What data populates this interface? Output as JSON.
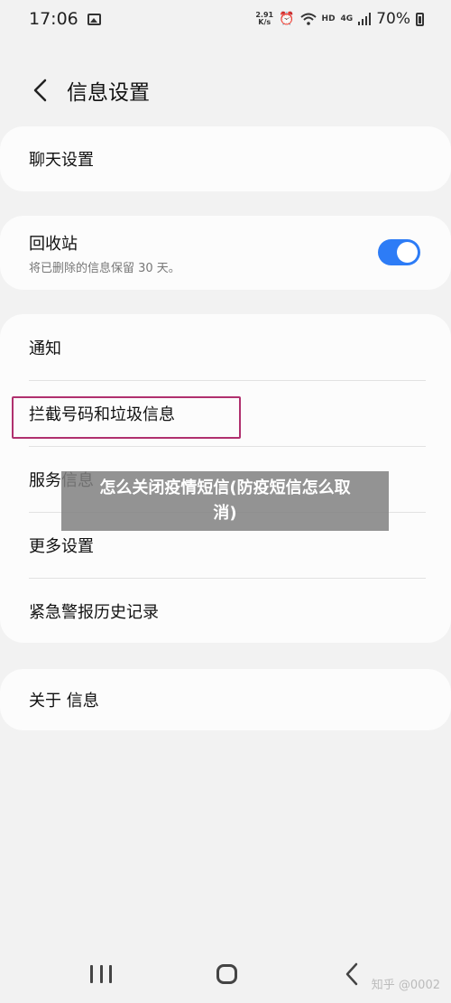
{
  "status_bar": {
    "time": "17:06",
    "net_speed_value": "2.91",
    "net_speed_unit": "K/s",
    "hd": "HD",
    "signal": "4G",
    "battery": "70%"
  },
  "header": {
    "title": "信息设置"
  },
  "settings": {
    "chat": "聊天设置",
    "recycle_bin": {
      "title": "回收站",
      "subtitle": "将已删除的信息保留 30 天。",
      "enabled": true
    },
    "items": [
      "通知",
      "拦截号码和垃圾信息",
      "服务信息",
      "更多设置",
      "紧急警报历史记录"
    ],
    "about": "关于 信息"
  },
  "overlay": {
    "line1": "怎么关闭疫情短信(防疫短信怎么取",
    "line2": "消)"
  },
  "watermark": "知乎 @0002",
  "colors": {
    "accent": "#2d7cf6",
    "highlight_border": "#b0306e",
    "background": "#f2f2f2"
  },
  "icons": [
    "gallery-icon",
    "alarm-icon",
    "wifi-icon",
    "signal-icon",
    "battery-icon",
    "back-icon",
    "recent-apps-icon",
    "home-icon",
    "nav-back-icon"
  ]
}
